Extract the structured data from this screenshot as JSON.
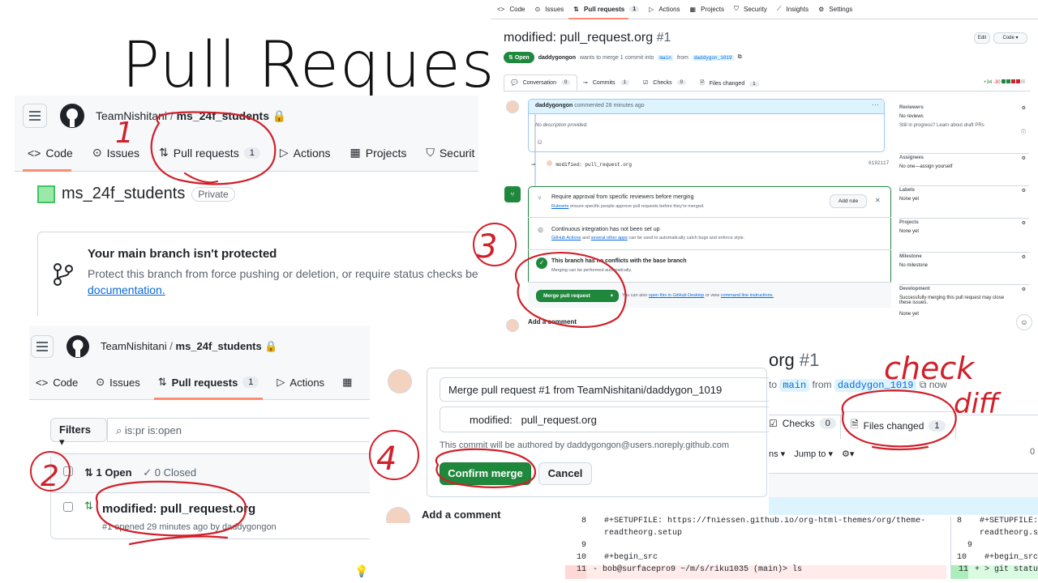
{
  "slide_title": "Pull Request",
  "repo_panel": {
    "owner": "TeamNishitani",
    "repo": "ms_24f_students",
    "tabs": [
      "Code",
      "Issues",
      "Pull requests",
      "Actions",
      "Projects",
      "Securit"
    ],
    "pr_count": "1",
    "repo_heading": "ms_24f_students",
    "visibility": "Private",
    "protect_title": "Your main branch isn't protected",
    "protect_body": "Protect this branch from force pushing or deletion, or require status checks before",
    "protect_link": "documentation."
  },
  "list_panel": {
    "owner": "TeamNishitani",
    "repo": "ms_24f_students",
    "tabs": [
      "Code",
      "Issues",
      "Pull requests",
      "Actions"
    ],
    "pr_count": "1",
    "filters_label": "Filters",
    "search_value": "is:pr is:open",
    "open_label": "1 Open",
    "closed_label": "0 Closed",
    "pr_title": "modified: pull_request.org",
    "pr_meta": "#1 opened 29 minutes ago by daddygongon"
  },
  "pr_panel": {
    "nav": [
      "Code",
      "Issues",
      "Pull requests",
      "Actions",
      "Projects",
      "Security",
      "Insights",
      "Settings"
    ],
    "nav_pr_count": "1",
    "title": "modified: pull_request.org",
    "number": "#1",
    "state": "Open",
    "author": "daddygongon",
    "merge_text": "wants to merge 1 commit into",
    "base": "main",
    "from_text": "from",
    "head": "daddygon_1019",
    "edit_label": "Edit",
    "code_label": "Code",
    "tabs": [
      {
        "label": "Conversation",
        "count": "0"
      },
      {
        "label": "Commits",
        "count": "1"
      },
      {
        "label": "Checks",
        "count": "0"
      },
      {
        "label": "Files changed",
        "count": "1"
      }
    ],
    "diffstat_add": "+34",
    "diffstat_del": "-30",
    "comment_author": "daddygongon",
    "comment_time": "commented 28 minutes ago",
    "comment_body": "No description provided.",
    "commit_msg": "modified: pull_request.org",
    "commit_sha": "6192117",
    "req_title": "Require approval from specific reviewers before merging",
    "req_link": "Rulesets",
    "req_body": "ensure specific people approve pull requests before they're merged.",
    "add_rule": "Add rule",
    "ci_title": "Continuous integration has not been set up",
    "ci_link1": "GitHub Actions",
    "ci_mid": "and",
    "ci_link2": "several other apps",
    "ci_body": "can be used to automatically catch bugs and enforce style.",
    "noconf_title": "This branch has no conflicts with the base branch",
    "noconf_body": "Merging can be performed automatically.",
    "merge_button": "Merge pull request",
    "also_text": "You can also",
    "also_link1": "open this in GitHub Desktop",
    "also_mid": "or view",
    "also_link2": "command line instructions.",
    "add_comment": "Add a comment",
    "sidebar": [
      {
        "title": "Reviewers",
        "lines": [
          "No reviews",
          "Still in progress? Learn about draft PRs"
        ]
      },
      {
        "title": "Assignees",
        "lines": [
          "No one—assign yourself"
        ]
      },
      {
        "title": "Labels",
        "lines": [
          "None yet"
        ]
      },
      {
        "title": "Projects",
        "lines": [
          "None yet"
        ]
      },
      {
        "title": "Milestone",
        "lines": [
          "No milestone"
        ]
      },
      {
        "title": "Development",
        "lines": [
          "Successfully merging this pull request may close these issues.",
          "None yet"
        ]
      }
    ]
  },
  "confirm_panel": {
    "title_value": "Merge pull request #1 from TeamNishitani/daddygon_1019",
    "body_value": "modified:   pull_request.org",
    "author_note": "This commit will be authored by daddygongon@users.noreply.github.com",
    "confirm_label": "Confirm merge",
    "cancel_label": "Cancel",
    "add_comment": "Add a comment"
  },
  "files_panel": {
    "title_tail": "org",
    "number": "#1",
    "to_text": "to",
    "base": "main",
    "from_text": "from",
    "head": "daddygon_1019",
    "time": "now",
    "checks_label": "Checks",
    "checks_count": "0",
    "files_label": "Files changed",
    "files_count": "1",
    "toolbar_left": "ns",
    "jump_label": "Jump to",
    "right_zero": "0"
  },
  "diff": {
    "lines": [
      {
        "num": "8",
        "text": "#+SETUPFILE: https://fniessen.github.io/org-html-themes/org/theme-",
        "type": "ctx"
      },
      {
        "num": "",
        "text": "readtheorg.setup",
        "type": "ctx"
      },
      {
        "num": "9",
        "text": "",
        "type": "ctx"
      },
      {
        "num": "10",
        "text": "#+begin_src",
        "type": "ctx"
      },
      {
        "num": "11",
        "text": "bob@surfacepro9 ~/m/s/riku1035 (main)> ls",
        "type": "del"
      }
    ],
    "right_lines": [
      {
        "num": "8",
        "text": "#+SETUPFILE:",
        "type": "ctx"
      },
      {
        "num": "",
        "text": "readtheorg.s",
        "type": "ctx"
      },
      {
        "num": "9",
        "text": "",
        "type": "ctx"
      },
      {
        "num": "10",
        "text": "#+begin_src",
        "type": "ctx"
      },
      {
        "num": "11",
        "text": "> git statu",
        "type": "add"
      }
    ]
  },
  "annotations": {
    "step1": "1",
    "step2": "2",
    "step3": "3",
    "step4": "4",
    "note_line1": "check",
    "note_line2": "diff"
  },
  "colors": {
    "accent_green": "#1f883d",
    "link_blue": "#0969da",
    "annotation_red": "#d0202a",
    "tab_underline": "#fd8c73"
  }
}
